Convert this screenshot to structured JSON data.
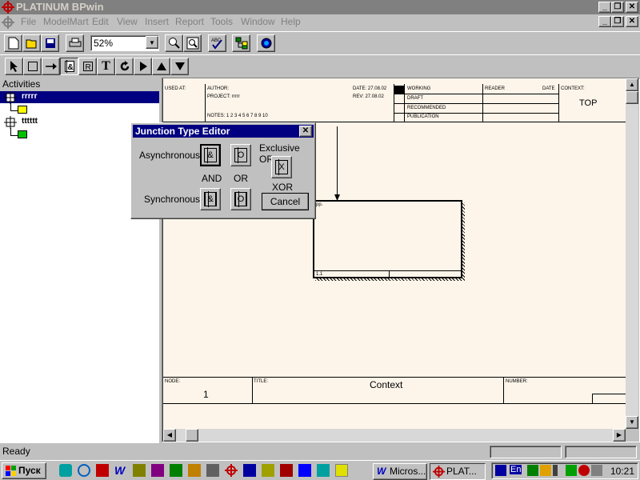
{
  "app": {
    "title": "PLATINUM BPwin"
  },
  "menu": {
    "file": "File",
    "modelmart": "ModelMart",
    "edit": "Edit",
    "view": "View",
    "insert": "Insert",
    "report": "Report",
    "tools": "Tools",
    "window": "Window",
    "help": "Help"
  },
  "toolbar": {
    "zoom_value": "52%"
  },
  "activities": {
    "header": "Activities",
    "items": [
      {
        "label": "rrrrr"
      },
      {
        "label": "tttttt"
      }
    ]
  },
  "frame": {
    "used_at": "USED AT:",
    "author": "AUTHOR:",
    "project": "PROJECT: rrrrr",
    "notes": "NOTES: 1 2 3 4 5 6 7 8 9 10",
    "date": "DATE: 27.08.02",
    "rev": "REV: 27.08.02",
    "working": "WORKING",
    "draft": "DRAFT",
    "recommended": "RECOMMENDED",
    "publication": "PUBLICATION",
    "reader": "READER",
    "date2": "DATE",
    "context": "CONTEXT:",
    "context_value": "TOP",
    "node": "NODE:",
    "node_value": "1",
    "title_lbl": "TITLE:",
    "title_value": "Context",
    "number": "NUMBER:",
    "box_label": "pp.",
    "box_num": "1.1"
  },
  "dialog": {
    "title": "Junction Type Editor",
    "asynchronous": "Asynchronous:",
    "synchronous": "Synchronous:",
    "and": "AND",
    "or": "OR",
    "exclusive_or": "Exclusive OR",
    "xor": "XOR",
    "cancel": "Cancel"
  },
  "status": {
    "text": "Ready"
  },
  "taskbar": {
    "start": "Пуск",
    "task1": "Micros...",
    "task2": "PLAT...",
    "clock": "10:21",
    "lang": "En"
  }
}
